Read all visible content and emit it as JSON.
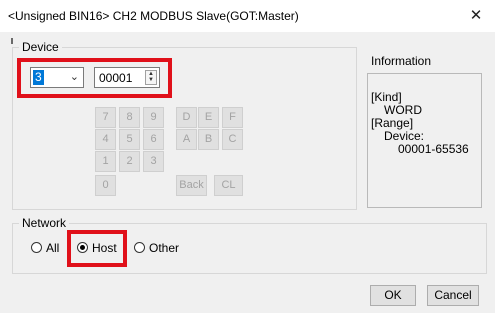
{
  "window": {
    "title": "<Unsigned BIN16> CH2 MODBUS Slave(GOT:Master)",
    "close_glyph": "✕"
  },
  "device": {
    "group_label": "Device",
    "station_value": "3",
    "address_value": "00001",
    "keypad": [
      [
        "7",
        "8",
        "9",
        "D",
        "E",
        "F"
      ],
      [
        "4",
        "5",
        "6",
        "A",
        "B",
        "C"
      ],
      [
        "1",
        "2",
        "3"
      ],
      [
        "0",
        "Back",
        "CL"
      ]
    ]
  },
  "information": {
    "label": "Information",
    "kind_heading": "[Kind]",
    "kind_value": "WORD",
    "range_heading": "[Range]",
    "range_sub": "Device:",
    "range_value": "00001-65536"
  },
  "network": {
    "group_label": "Network",
    "options": [
      "All",
      "Host",
      "Other"
    ],
    "selected": "Host"
  },
  "buttons": {
    "ok": "OK",
    "cancel": "Cancel"
  },
  "colors": {
    "highlight": "#e0101a",
    "selection": "#0078d7"
  }
}
